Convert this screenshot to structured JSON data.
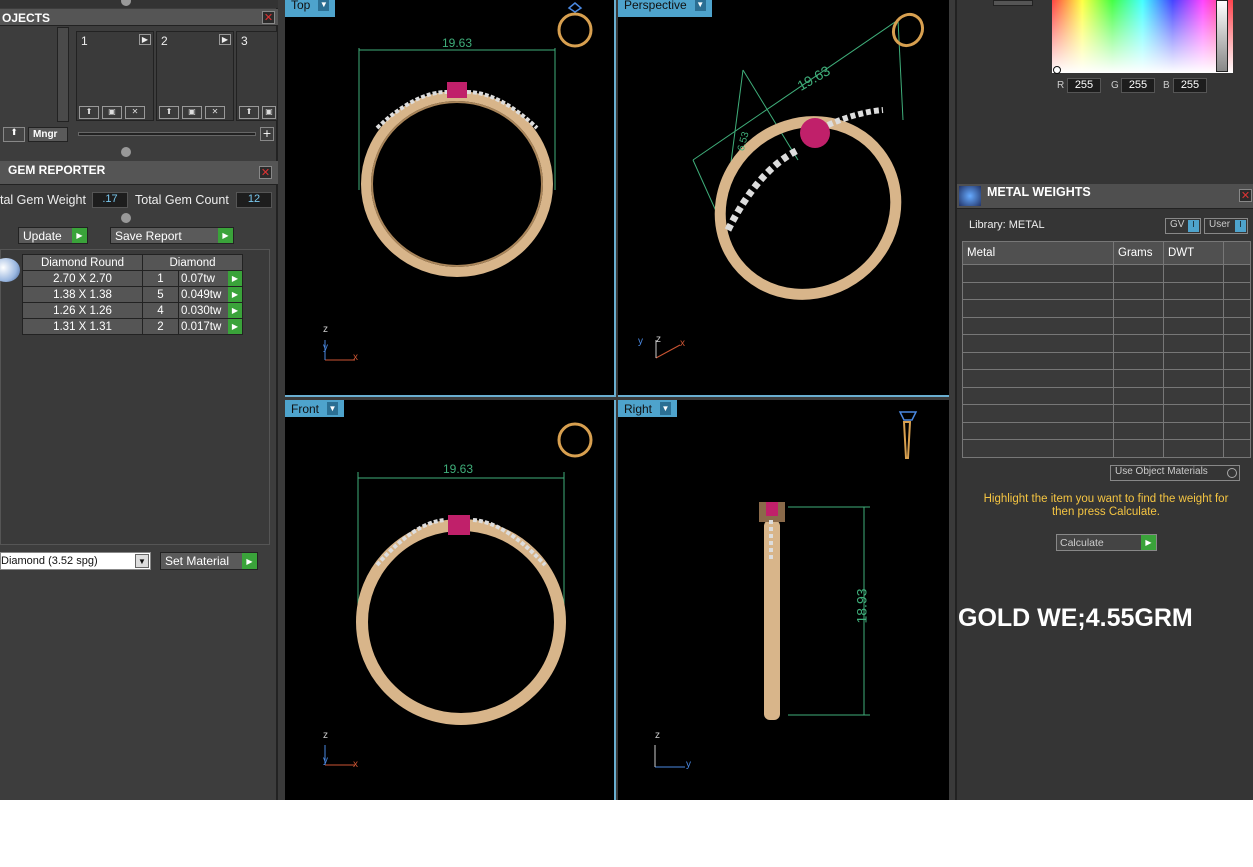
{
  "left": {
    "objects_title": "OJECTS",
    "slots": [
      "1",
      "2",
      "3"
    ],
    "mngr_label": "Mngr",
    "gem_reporter_title": "GEM REPORTER",
    "total_gem_weight_label": "tal Gem Weight",
    "total_gem_weight_value": ".17",
    "total_gem_count_label": "Total Gem Count",
    "total_gem_count_value": "12",
    "update_label": "Update",
    "save_report_label": "Save Report",
    "table_headers": [
      "Diamond Round",
      "Diamond"
    ],
    "rows": [
      {
        "size": "2.70 X 2.70",
        "count": "1",
        "weight": "0.07tw"
      },
      {
        "size": "1.38 X 1.38",
        "count": "5",
        "weight": "0.049tw"
      },
      {
        "size": "1.26 X 1.26",
        "count": "4",
        "weight": "0.030tw"
      },
      {
        "size": "1.31 X 1.31",
        "count": "2",
        "weight": "0.017tw"
      }
    ],
    "material_select": "Diamond   (3.52 spg)",
    "set_material_label": "Set Material"
  },
  "viewports": {
    "top": {
      "label": "Top",
      "dimension": "19.63"
    },
    "perspective": {
      "label": "Perspective",
      "dimension": "19.63",
      "dimension2": "6.53"
    },
    "front": {
      "label": "Front",
      "dimension": "19.63"
    },
    "right": {
      "label": "Right",
      "dimension": "18.93"
    }
  },
  "axes": {
    "x": "x",
    "y": "y",
    "z": "z"
  },
  "color_picker": {
    "r_label": "R",
    "r": "255",
    "g_label": "G",
    "g": "255",
    "b_label": "B",
    "b": "255"
  },
  "metal": {
    "title": "METAL WEIGHTS",
    "library": "Library: METAL",
    "gv": "GV",
    "user": "User",
    "headers": [
      "Metal",
      "Grams",
      "DWT"
    ],
    "use_object_materials": "Use Object Materials",
    "instruction": "Highlight the item you want to find the weight for then press Calculate.",
    "calculate_label": "Calculate",
    "gold_note": "GOLD WE;4.55GRM"
  },
  "colors": {
    "ring": "#d8b58a",
    "gem": "#c0206a",
    "dimension": "#3fae7a",
    "tab": "#4ea3cc"
  }
}
